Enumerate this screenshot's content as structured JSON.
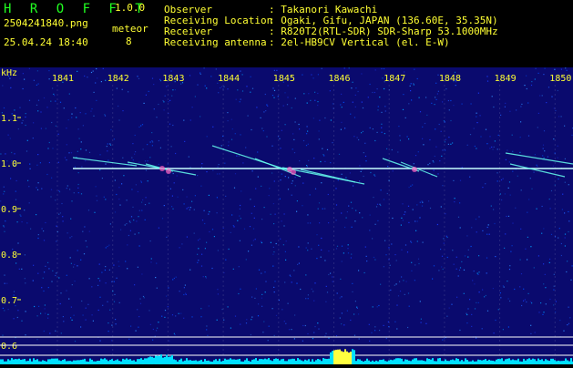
{
  "header": {
    "app_title": "H R O F F T",
    "version": "1.0.0",
    "filename": "2504241840.png",
    "datetime": "25.04.24 18:40",
    "meteor_label": "meteor",
    "meteor_count": "8",
    "info": [
      {
        "label": "Observer",
        "value": ": Takanori Kawachi"
      },
      {
        "label": "Receiving Location",
        "value": ": Ogaki, Gifu, JAPAN (136.60E, 35.35N)"
      },
      {
        "label": "Receiver",
        "value": ": R820T2(RTL-SDR) SDR-Sharp 53.1000MHz"
      },
      {
        "label": "Receiving antenna",
        "value": ": 2el-HB9CV Vertical (el. E-W)"
      }
    ]
  },
  "spectrogram": {
    "y_unit": "kHz",
    "x_ticks": [
      "1841",
      "1842",
      "1843",
      "1844",
      "1845",
      "1846",
      "1847",
      "1848",
      "1849",
      "1850"
    ],
    "y_ticks": [
      "1.1",
      "1.0",
      "0.9",
      "0.8",
      "0.7",
      "0.6"
    ],
    "colors": {
      "background": "#0a0a6e",
      "carrier": "#c8ffff",
      "grid": "#ffffff",
      "noise": "#00e0ff",
      "axis_text": "#ffff33"
    }
  }
}
